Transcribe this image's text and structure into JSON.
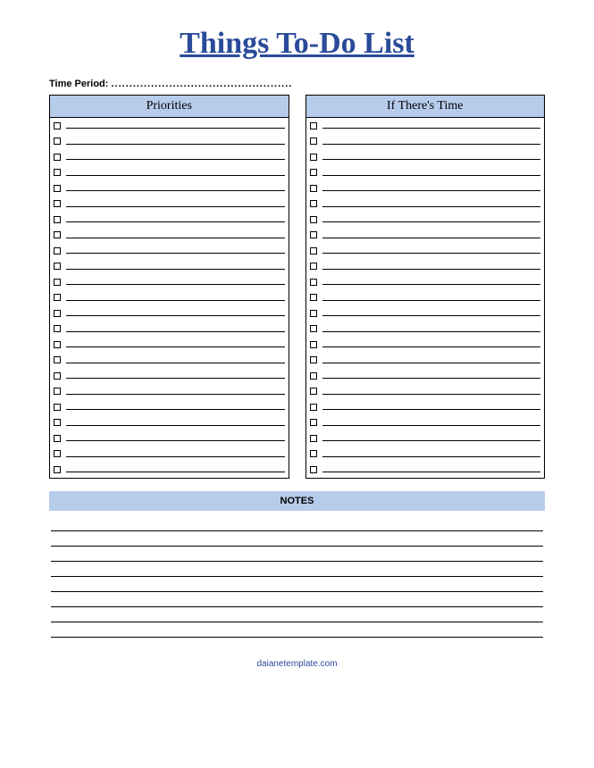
{
  "title": "Things To-Do List",
  "time_period_label": "Time Period:",
  "time_period_dots": "..................................................",
  "columns": {
    "left_header": "Priorities",
    "right_header": "If There's Time",
    "row_count": 23
  },
  "notes": {
    "header": "NOTES",
    "line_count": 8
  },
  "footer": "daianetemplate.com"
}
